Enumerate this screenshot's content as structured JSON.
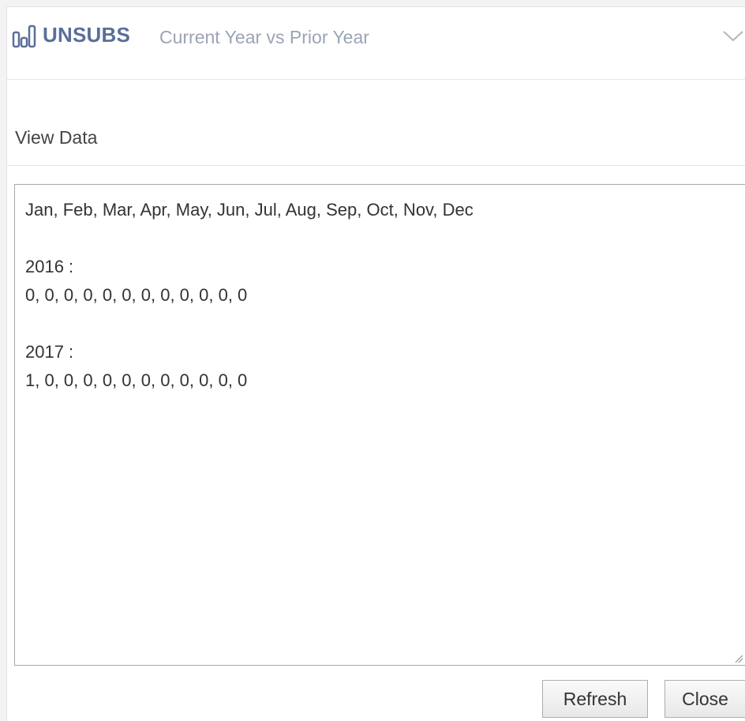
{
  "header": {
    "title": "UNSUBS",
    "subtitle": "Current Year vs Prior Year",
    "icon": "bar-chart-icon",
    "collapse_icon": "chevron-down-icon"
  },
  "section": {
    "label": "View Data"
  },
  "data_view": {
    "lines": [
      "Jan, Feb, Mar, Apr, May, Jun, Jul, Aug, Sep, Oct, Nov, Dec",
      "",
      "2016 :",
      "0, 0, 0, 0, 0, 0, 0, 0, 0, 0, 0, 0",
      "",
      "2017 :",
      "1, 0, 0, 0, 0, 0, 0, 0, 0, 0, 0, 0"
    ]
  },
  "buttons": {
    "refresh_label": "Refresh",
    "close_label": "Close"
  },
  "colors": {
    "title": "#5a6f99",
    "subtitle": "#9aa4b5"
  }
}
